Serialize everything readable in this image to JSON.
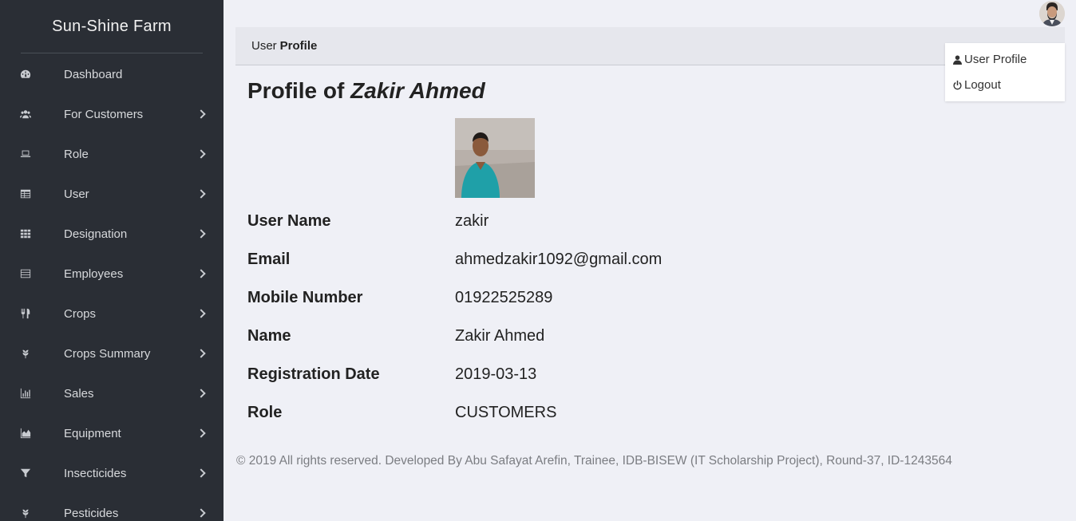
{
  "brand": "Sun-Shine Farm",
  "sidebar": {
    "items": [
      {
        "label": "Dashboard",
        "icon": "dashboard-icon"
      },
      {
        "label": "For Customers",
        "icon": "users-icon"
      },
      {
        "label": "Role",
        "icon": "laptop-icon"
      },
      {
        "label": "User",
        "icon": "table-icon"
      },
      {
        "label": "Designation",
        "icon": "grid-icon"
      },
      {
        "label": "Employees",
        "icon": "list-icon"
      },
      {
        "label": "Crops",
        "icon": "utensils-icon"
      },
      {
        "label": "Crops Summary",
        "icon": "leaf-icon"
      },
      {
        "label": "Sales",
        "icon": "bar-chart-icon"
      },
      {
        "label": "Equipment",
        "icon": "area-chart-icon"
      },
      {
        "label": "Insecticides",
        "icon": "filter-icon"
      },
      {
        "label": "Pesticides",
        "icon": "leaf-icon"
      }
    ]
  },
  "breadcrumb": {
    "prefix": "User",
    "current": "Profile"
  },
  "dropdown": {
    "profile_label": "User Profile",
    "logout_label": "Logout"
  },
  "profile": {
    "title_prefix": "Profile of",
    "title_name": "Zakir Ahmed",
    "fields": [
      {
        "label": "User Name",
        "value": "zakir"
      },
      {
        "label": "Email",
        "value": "ahmedzakir1092@gmail.com"
      },
      {
        "label": "Mobile Number",
        "value": "01922525289"
      },
      {
        "label": "Name",
        "value": "Zakir Ahmed"
      },
      {
        "label": "Registration Date",
        "value": "2019-03-13"
      },
      {
        "label": "Role",
        "value": "CUSTOMERS"
      }
    ]
  },
  "footer": "© 2019 All rights reserved. Developed By Abu Safayat Arefin, Trainee, IDB-BISEW (IT Scholarship Project), Round-37, ID-1243564"
}
